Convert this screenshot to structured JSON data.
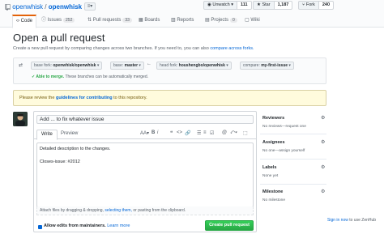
{
  "repo": {
    "owner": "openwhisk",
    "separator": "/",
    "name": "openwhisk"
  },
  "pin_icon": "list-icon",
  "actions": {
    "watch": {
      "label": "Unwatch ▾",
      "count": "111"
    },
    "star": {
      "label": "Star",
      "count": "1,187"
    },
    "fork": {
      "label": "Fork",
      "count": "240"
    }
  },
  "tabs": [
    {
      "label": "Code",
      "count": "",
      "icon": "code-icon"
    },
    {
      "label": "Issues",
      "count": "252",
      "icon": "issue-icon"
    },
    {
      "label": "Pull requests",
      "count": "33",
      "icon": "pull-request-icon"
    },
    {
      "label": "Boards",
      "count": "",
      "icon": "board-icon"
    },
    {
      "label": "Reports",
      "count": "",
      "icon": "graph-icon"
    },
    {
      "label": "Projects",
      "count": "0",
      "icon": "project-icon"
    },
    {
      "label": "Wiki",
      "count": "",
      "icon": "book-icon"
    }
  ],
  "page": {
    "title": "Open a pull request",
    "subtitle_text": "Create a new pull request by comparing changes across two branches. If you need to, you can also",
    "subtitle_link": "compare across forks."
  },
  "compare": {
    "base_fork_label": "base fork:",
    "base_fork": "openwhisk/openwhisk",
    "base_label": "base:",
    "base": "master",
    "head_fork_label": "head fork:",
    "head_fork": "houshengbo/openwhisk",
    "compare_label": "compare:",
    "compare": "my-first-issue",
    "able": "✓ Able to merge.",
    "merge_note": "These branches can be automatically merged."
  },
  "flash": {
    "prefix": "Please review the",
    "link": "guidelines for contributing",
    "suffix": "to this repository."
  },
  "form": {
    "title_value": "Add ... to fix whatever issue",
    "tab_write": "Write",
    "tab_preview": "Preview",
    "toolbar": [
      "AA▾",
      "B",
      "i",
      "❝",
      "<>",
      "🔗",
      "☰",
      "≡",
      "☑",
      "@",
      "⤺▾",
      "⬚"
    ],
    "body_line1": "Detailed description to the changes.",
    "body_line2": "Closes-issue: #2012",
    "attach_text": "Attach files by dragging & dropping,",
    "attach_link": "selecting them,",
    "attach_suffix": "or pasting from the clipboard.",
    "allow_label": "Allow edits from maintainers.",
    "learn_more": "Learn more",
    "submit": "Create pull request"
  },
  "sidebar": {
    "reviewers": {
      "title": "Reviewers",
      "value": "No reviews—request one"
    },
    "assignees": {
      "title": "Assignees",
      "value": "No one—assign yourself"
    },
    "labels": {
      "title": "Labels",
      "value": "None yet"
    },
    "milestone": {
      "title": "Milestone",
      "value": "No milestone"
    }
  },
  "zenhub": {
    "link": "Sign in now",
    "suffix": "to use ZenHub"
  },
  "colors": {
    "accent": "#0366d6",
    "success": "#28a745",
    "tab_highlight": "#e36209",
    "flash_bg": "#fffbdd"
  }
}
